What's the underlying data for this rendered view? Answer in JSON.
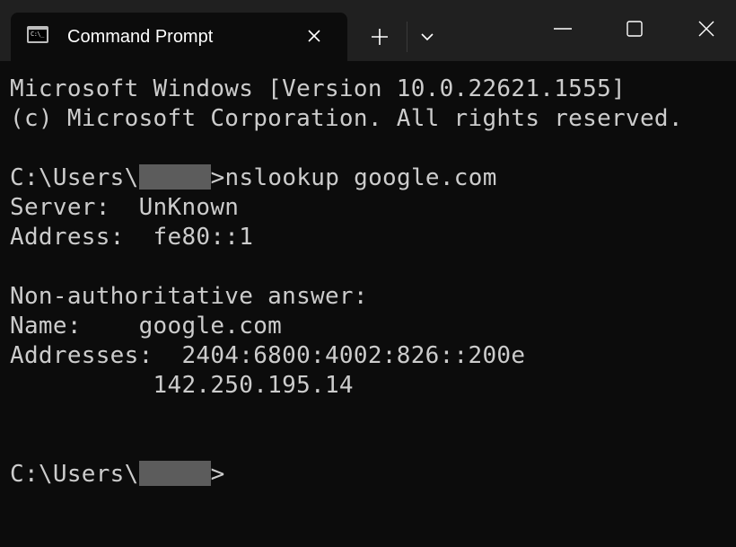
{
  "window": {
    "tab_title": "Command Prompt",
    "tab_icon": "cmd-icon",
    "tab_icon_prompt": "C:\\_"
  },
  "console": {
    "banner_line1": "Microsoft Windows [Version 10.0.22621.1555]",
    "banner_line2": "(c) Microsoft Corporation. All rights reserved.",
    "prompt1_prefix": "C:\\Users\\",
    "prompt1_suffix": ">nslookup google.com",
    "server_line": "Server:  UnKnown",
    "address_line": "Address:  fe80::1",
    "nonauth_line": "Non-authoritative answer:",
    "name_line": "Name:    google.com",
    "addresses_line": "Addresses:  2404:6800:4002:826::200e",
    "addresses_line2": "          142.250.195.14",
    "prompt2_prefix": "C:\\Users\\",
    "prompt2_suffix": ">"
  },
  "colors": {
    "background": "#0c0c0c",
    "titlebar": "#202020",
    "text": "#cccccc",
    "redaction": "#5c5c5c"
  }
}
